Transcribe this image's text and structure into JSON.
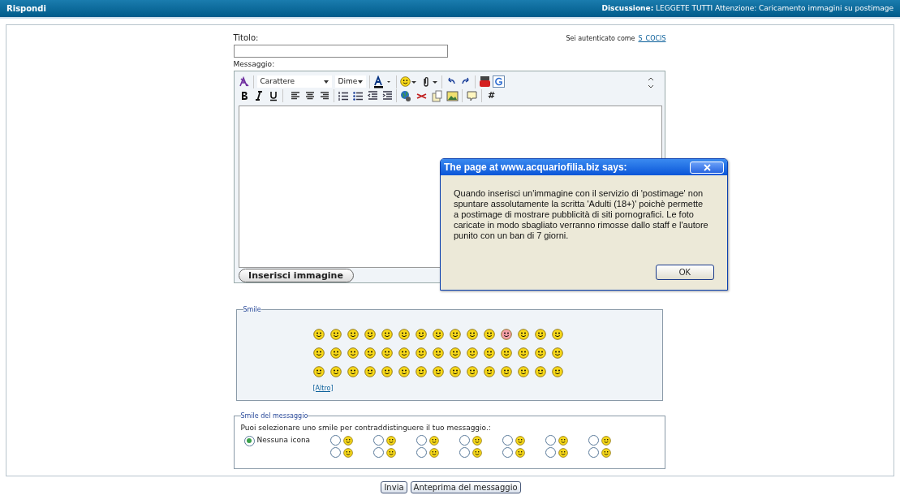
{
  "header": {
    "title": "Rispondi",
    "discussion": "**Discussione:** LEGGETE TUTTI Attenzione: Caricamento immagini su postimage"
  },
  "form": {
    "title_label": "Titolo:",
    "auth_text": "Sei autenticato come",
    "username": "S_COCIS",
    "message_label": "Messaggio:"
  },
  "toolbar": {
    "font_select": "Carattere",
    "size_select": "Dime",
    "hash_button": "#"
  },
  "insert_image_button": "Inserisci immagine",
  "smile_panel": {
    "legend": "Smile",
    "more_link": "[Altro]"
  },
  "message_icon_panel": {
    "legend": "Smile del messaggio",
    "instruction": "Puoi selezionare uno smile per contraddistinguere il tuo messaggio.:",
    "options": [
      {
        "kind": "text",
        "label": "Nessuna icona",
        "selected": true
      },
      {
        "kind": "icon",
        "selected": false
      },
      {
        "kind": "icon",
        "selected": false
      },
      {
        "kind": "icon",
        "selected": false
      },
      {
        "kind": "icon",
        "selected": false
      },
      {
        "kind": "icon",
        "selected": false
      },
      {
        "kind": "icon",
        "selected": false
      },
      {
        "kind": "icon",
        "selected": false
      },
      {
        "kind": "icon",
        "selected": false
      },
      {
        "kind": "icon",
        "selected": false
      },
      {
        "kind": "icon",
        "selected": false
      },
      {
        "kind": "icon",
        "selected": false
      },
      {
        "kind": "icon",
        "selected": false
      },
      {
        "kind": "icon",
        "selected": false
      },
      {
        "kind": "icon",
        "selected": false
      }
    ]
  },
  "buttons": [
    "Invia",
    "Anteprima del messaggio"
  ],
  "dialog": {
    "title": "The page at www.acquariofilia.biz says:",
    "message": "Quando inserisci un'immagine con il servizio di 'postimage' non spuntare assolutamente la scritta 'Adulti (18+)' poichè permette a postimage di mostrare pubblicità di siti pornografici. Le foto caricate in modo sbagliato verranno rimosse dallo staff e l'autore punito con un ban di 7 giorni.",
    "ok": "OK"
  }
}
